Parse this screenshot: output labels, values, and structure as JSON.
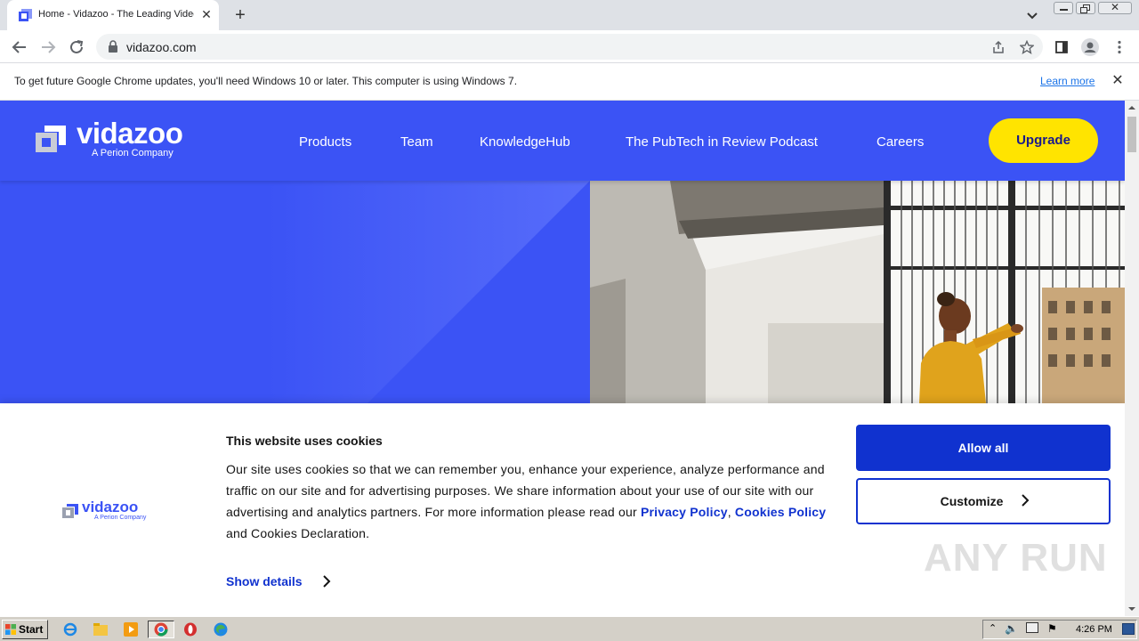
{
  "browser": {
    "tab_title": "Home - Vidazoo - The Leading Video",
    "new_tab_icon": "plus-icon",
    "url": "vidazoo.com",
    "infobar": {
      "message": "To get future Google Chrome updates, you'll need Windows 10 or later. This computer is using Windows 7.",
      "link": "Learn more"
    }
  },
  "site": {
    "logo": {
      "word": "vidazoo",
      "sub": "A Perion Company"
    },
    "nav": [
      "Products",
      "Team",
      "KnowledgeHub",
      "The PubTech in Review Podcast",
      "Careers"
    ],
    "upgrade_label": "Upgrade",
    "brand_color": "#3b53f5",
    "accent_color": "#ffe400"
  },
  "cookie_banner": {
    "title": "This website uses cookies",
    "body_before": "Our site uses cookies so that we can remember you, enhance your experience, analyze performance and traffic on our site and for advertising purposes. We share information about your use of our site with our advertising and analytics partners. For more information please read our ",
    "privacy_link": "Privacy Policy",
    "comma": ",",
    "cookies_link": "Cookies Policy",
    "body_after": " and Cookies Declaration.",
    "show_details": "Show details",
    "allow_all": "Allow all",
    "customize": "Customize",
    "logo_word": "vidazoo",
    "logo_sub": "A Perion Company"
  },
  "watermark": "ANY RUN",
  "taskbar": {
    "start_label": "Start",
    "clock": "4:26 PM"
  }
}
